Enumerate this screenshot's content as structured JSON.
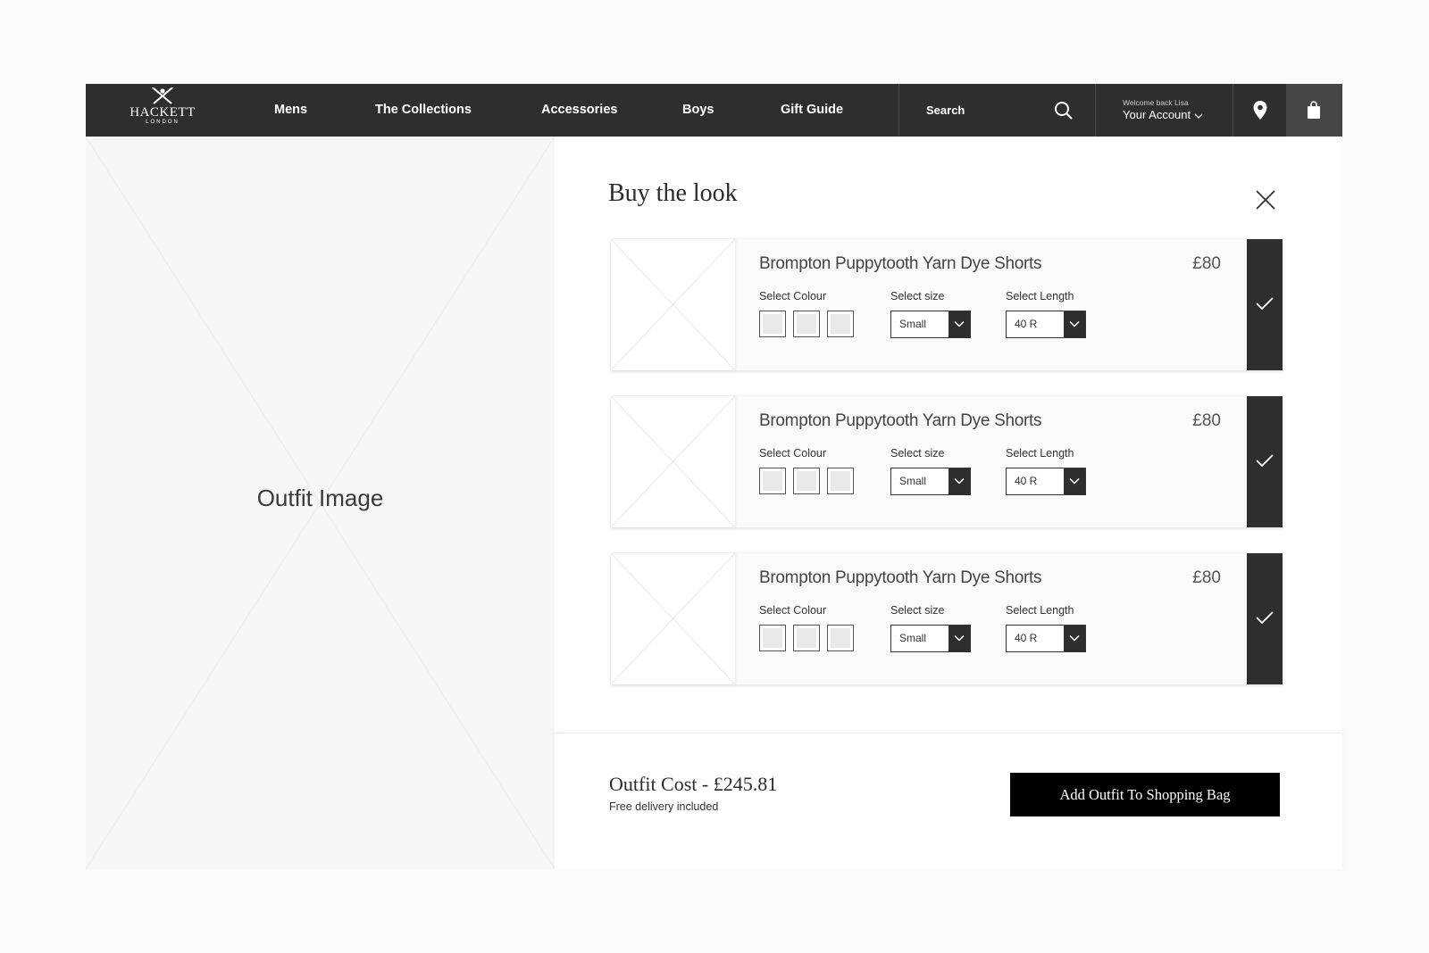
{
  "header": {
    "logo": {
      "name": "HACKETT",
      "sub": "LONDON",
      "icon": "crossed-swords-logo"
    },
    "nav": [
      {
        "label": "Mens"
      },
      {
        "label": "The Collections"
      },
      {
        "label": "Accessories"
      },
      {
        "label": "Boys"
      },
      {
        "label": "Gift Guide"
      }
    ],
    "search": {
      "label": "Search",
      "icon": "search-icon"
    },
    "account": {
      "welcome": "Welcome back Lisa",
      "label": "Your Account",
      "icon": "chevron-down-icon"
    },
    "store_icon": "location-pin-icon",
    "bag_icon": "shopping-bag-icon"
  },
  "outfit": {
    "label": "Outfit Image"
  },
  "panel": {
    "title": "Buy the look",
    "close_icon": "close-icon",
    "products": [
      {
        "name": "Brompton Puppytooth Yarn Dye Shorts",
        "price": "£80",
        "colour_label": "Select Colour",
        "size_label": "Select size",
        "size_value": "Small",
        "length_label": "Select Length",
        "length_value": "40 R",
        "selected": true
      },
      {
        "name": "Brompton Puppytooth Yarn Dye Shorts",
        "price": "£80",
        "colour_label": "Select Colour",
        "size_label": "Select size",
        "size_value": "Small",
        "length_label": "Select Length",
        "length_value": "40 R",
        "selected": true
      },
      {
        "name": "Brompton Puppytooth Yarn Dye Shorts",
        "price": "£80",
        "colour_label": "Select Colour",
        "size_label": "Select size",
        "size_value": "Small",
        "length_label": "Select Length",
        "length_value": "40 R",
        "selected": true
      }
    ]
  },
  "footer": {
    "total": "Outfit Cost - £245.81",
    "delivery": "Free delivery included",
    "add_button": "Add Outfit To Shopping Bag"
  },
  "colors": {
    "nav_bg": "#2e2e2e",
    "accent": "#000000",
    "page_bg": "#fafafa"
  }
}
